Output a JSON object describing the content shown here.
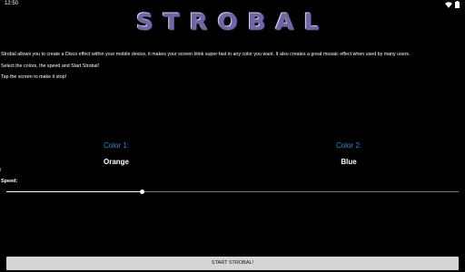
{
  "status_bar": {
    "time": "12:50",
    "icons": [
      "wifi-icon",
      "battery-icon"
    ]
  },
  "app": {
    "logo_text": "STROBAL"
  },
  "description": [
    "Strobal allows you to create a Disco effect within your mobile device, it makes your screen blink super-fast in any color you want. It also creates a great mosaic effect when used by many users.",
    "Select the colors, the speed and Start Strobal!",
    "Tap the screen to make it stop!"
  ],
  "colors": {
    "color1": {
      "label": "Color 1:",
      "value": "Orange"
    },
    "color2": {
      "label": "Color 2:",
      "value": "Blue"
    },
    "label_color": "#2d8ad6"
  },
  "speed": {
    "label": "Speed:",
    "value_fraction": 0.3
  },
  "start_button": {
    "label": "START STROBAL!"
  }
}
